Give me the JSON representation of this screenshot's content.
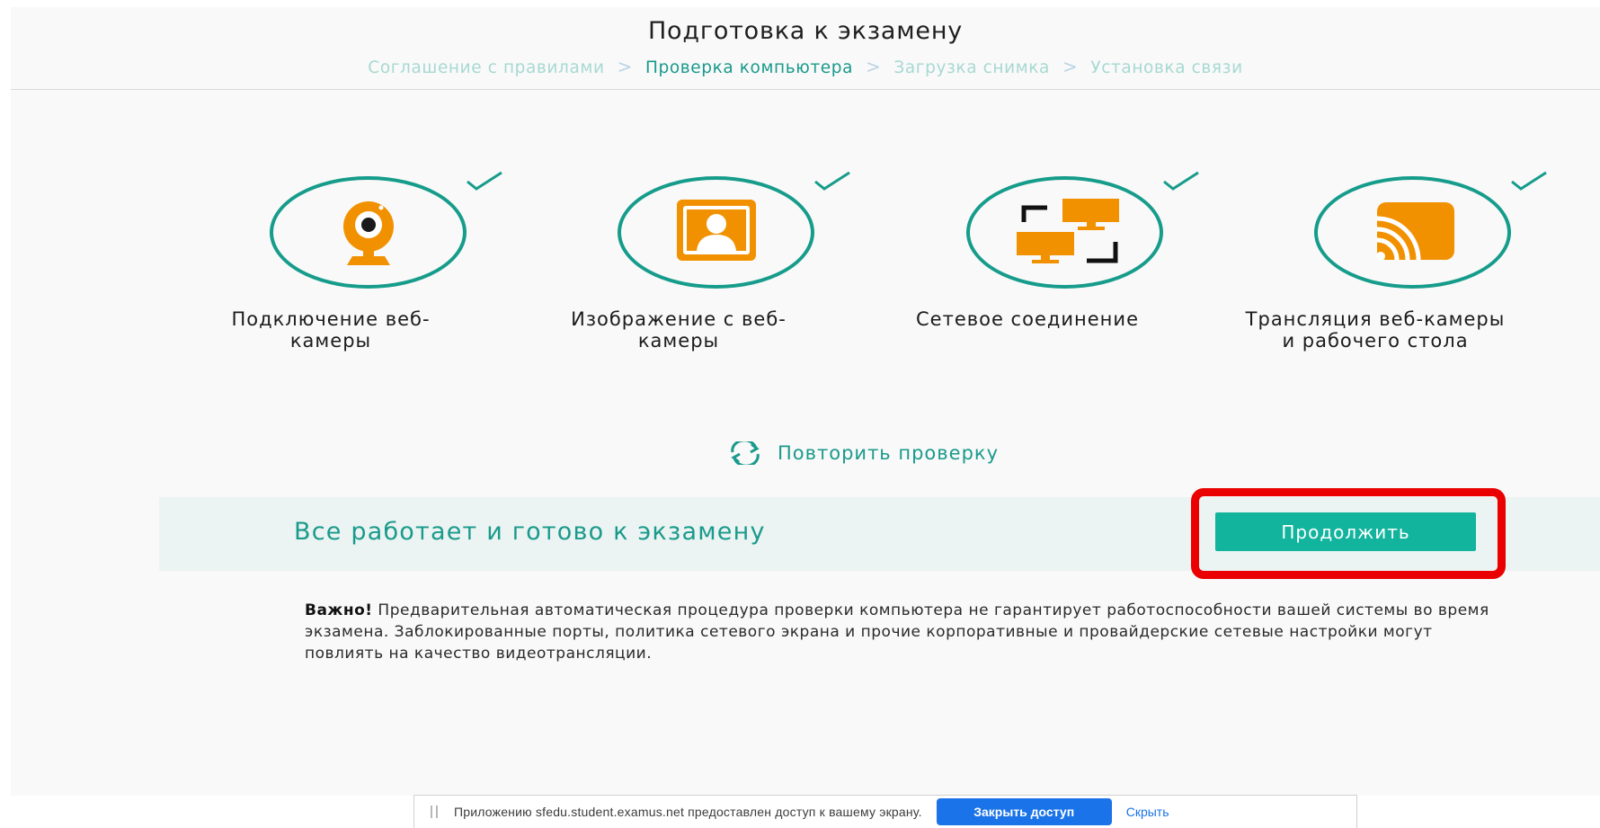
{
  "header": {
    "title": "Подготовка к экзамену",
    "breadcrumb": [
      {
        "label": "Соглашение с правилами",
        "active": false
      },
      {
        "label": "Проверка компьютера",
        "active": true
      },
      {
        "label": "Загрузка снимка",
        "active": false
      },
      {
        "label": "Установка связи",
        "active": false
      }
    ],
    "separator": ">"
  },
  "checks": [
    {
      "icon": "webcam-icon",
      "label": "Подключение веб-камеры",
      "status": "ok"
    },
    {
      "icon": "user-portrait-icon",
      "label": "Изображение с веб-камеры",
      "status": "ok"
    },
    {
      "icon": "network-monitors-icon",
      "label": "Сетевое соединение",
      "status": "ok"
    },
    {
      "icon": "cast-icon",
      "label": "Трансляция веб-камеры и рабочего стола",
      "status": "ok"
    }
  ],
  "repeat": {
    "icon": "refresh-icon",
    "label": "Повторить проверку"
  },
  "status": {
    "text": "Все работает и готово к экзамену",
    "button_label": "Продолжить"
  },
  "notice": {
    "bold": "Важно!",
    "text": " Предварительная автоматическая процедура проверки компьютера не гарантирует работоспособности вашей системы во время экзамена. Заблокированные порты, политика сетевого экрана и прочие корпоративные и провайдерские сетевые настройки могут повлиять на качество видеотрансляции."
  },
  "share_bar": {
    "text": "Приложению sfedu.student.examus.net предоставлен доступ к вашему экрану.",
    "stop_label": "Закрыть доступ",
    "hide_label": "Скрыть"
  },
  "colors": {
    "accent": "#1a9a8c",
    "button": "#12b49e",
    "icon_orange": "#f29100",
    "highlight": "#ea0000",
    "chrome_blue": "#1a73e8"
  }
}
